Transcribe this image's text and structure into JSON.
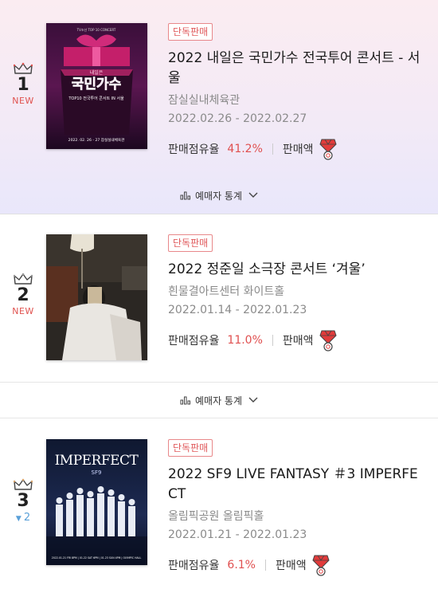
{
  "items": [
    {
      "rank": "1",
      "change": "NEW",
      "badge": "단독판매",
      "title": "2022 내일은 국민가수 전국투어 콘서트 - 서울",
      "venue": "잠실실내체육관",
      "dates": "2022.02.26  - 2022.02.27",
      "share_label": "판매점유율",
      "share_value": "41.2%",
      "sales_label": "판매액",
      "stats_toggle": "예매자 통계",
      "poster": {
        "top_line": "TV조선 TOP 10 CONCERT",
        "script": "내일은",
        "big": "국민가수",
        "sub": "TOP10 전국투어 콘서트 IN 서울",
        "date": "2022. 02. 26 - 27 잠실실내체육관"
      }
    },
    {
      "rank": "2",
      "change": "NEW",
      "badge": "단독판매",
      "title": "2022 정준일 소극장 콘서트 ‘겨울’",
      "venue": "흰물결아트센터 화이트홀",
      "dates": "2022.01.14  - 2022.01.23",
      "share_label": "판매점유율",
      "share_value": "11.0%",
      "sales_label": "판매액",
      "stats_toggle": "예매자 통계"
    },
    {
      "rank": "3",
      "change": "2",
      "badge": "단독판매",
      "title": "2022 SF9 LIVE FANTASY ＃3 IMPERFECT",
      "venue": "올림픽공원 올림픽홀",
      "dates": "2022.01.21  - 2022.01.23",
      "share_label": "판매점유율",
      "share_value": "6.1%",
      "sales_label": "판매액",
      "poster": {
        "big": "IMPERFECT",
        "sub": "SF9",
        "date": "2022.01.21 FRI 8PM | 01.22 SAT 6PM | 01.23 SUN 4PM | OLYMPIC HALL"
      }
    }
  ],
  "colors": {
    "accent": "#e05050",
    "badge": "#e8888a",
    "new": "#e0524f",
    "down": "#5aa0d8",
    "muted": "#8a8a8a"
  },
  "icons": [
    "crown-icon",
    "gem-medal-icon",
    "bar-chart-icon",
    "chevron-down-icon",
    "triangle-down-icon"
  ]
}
